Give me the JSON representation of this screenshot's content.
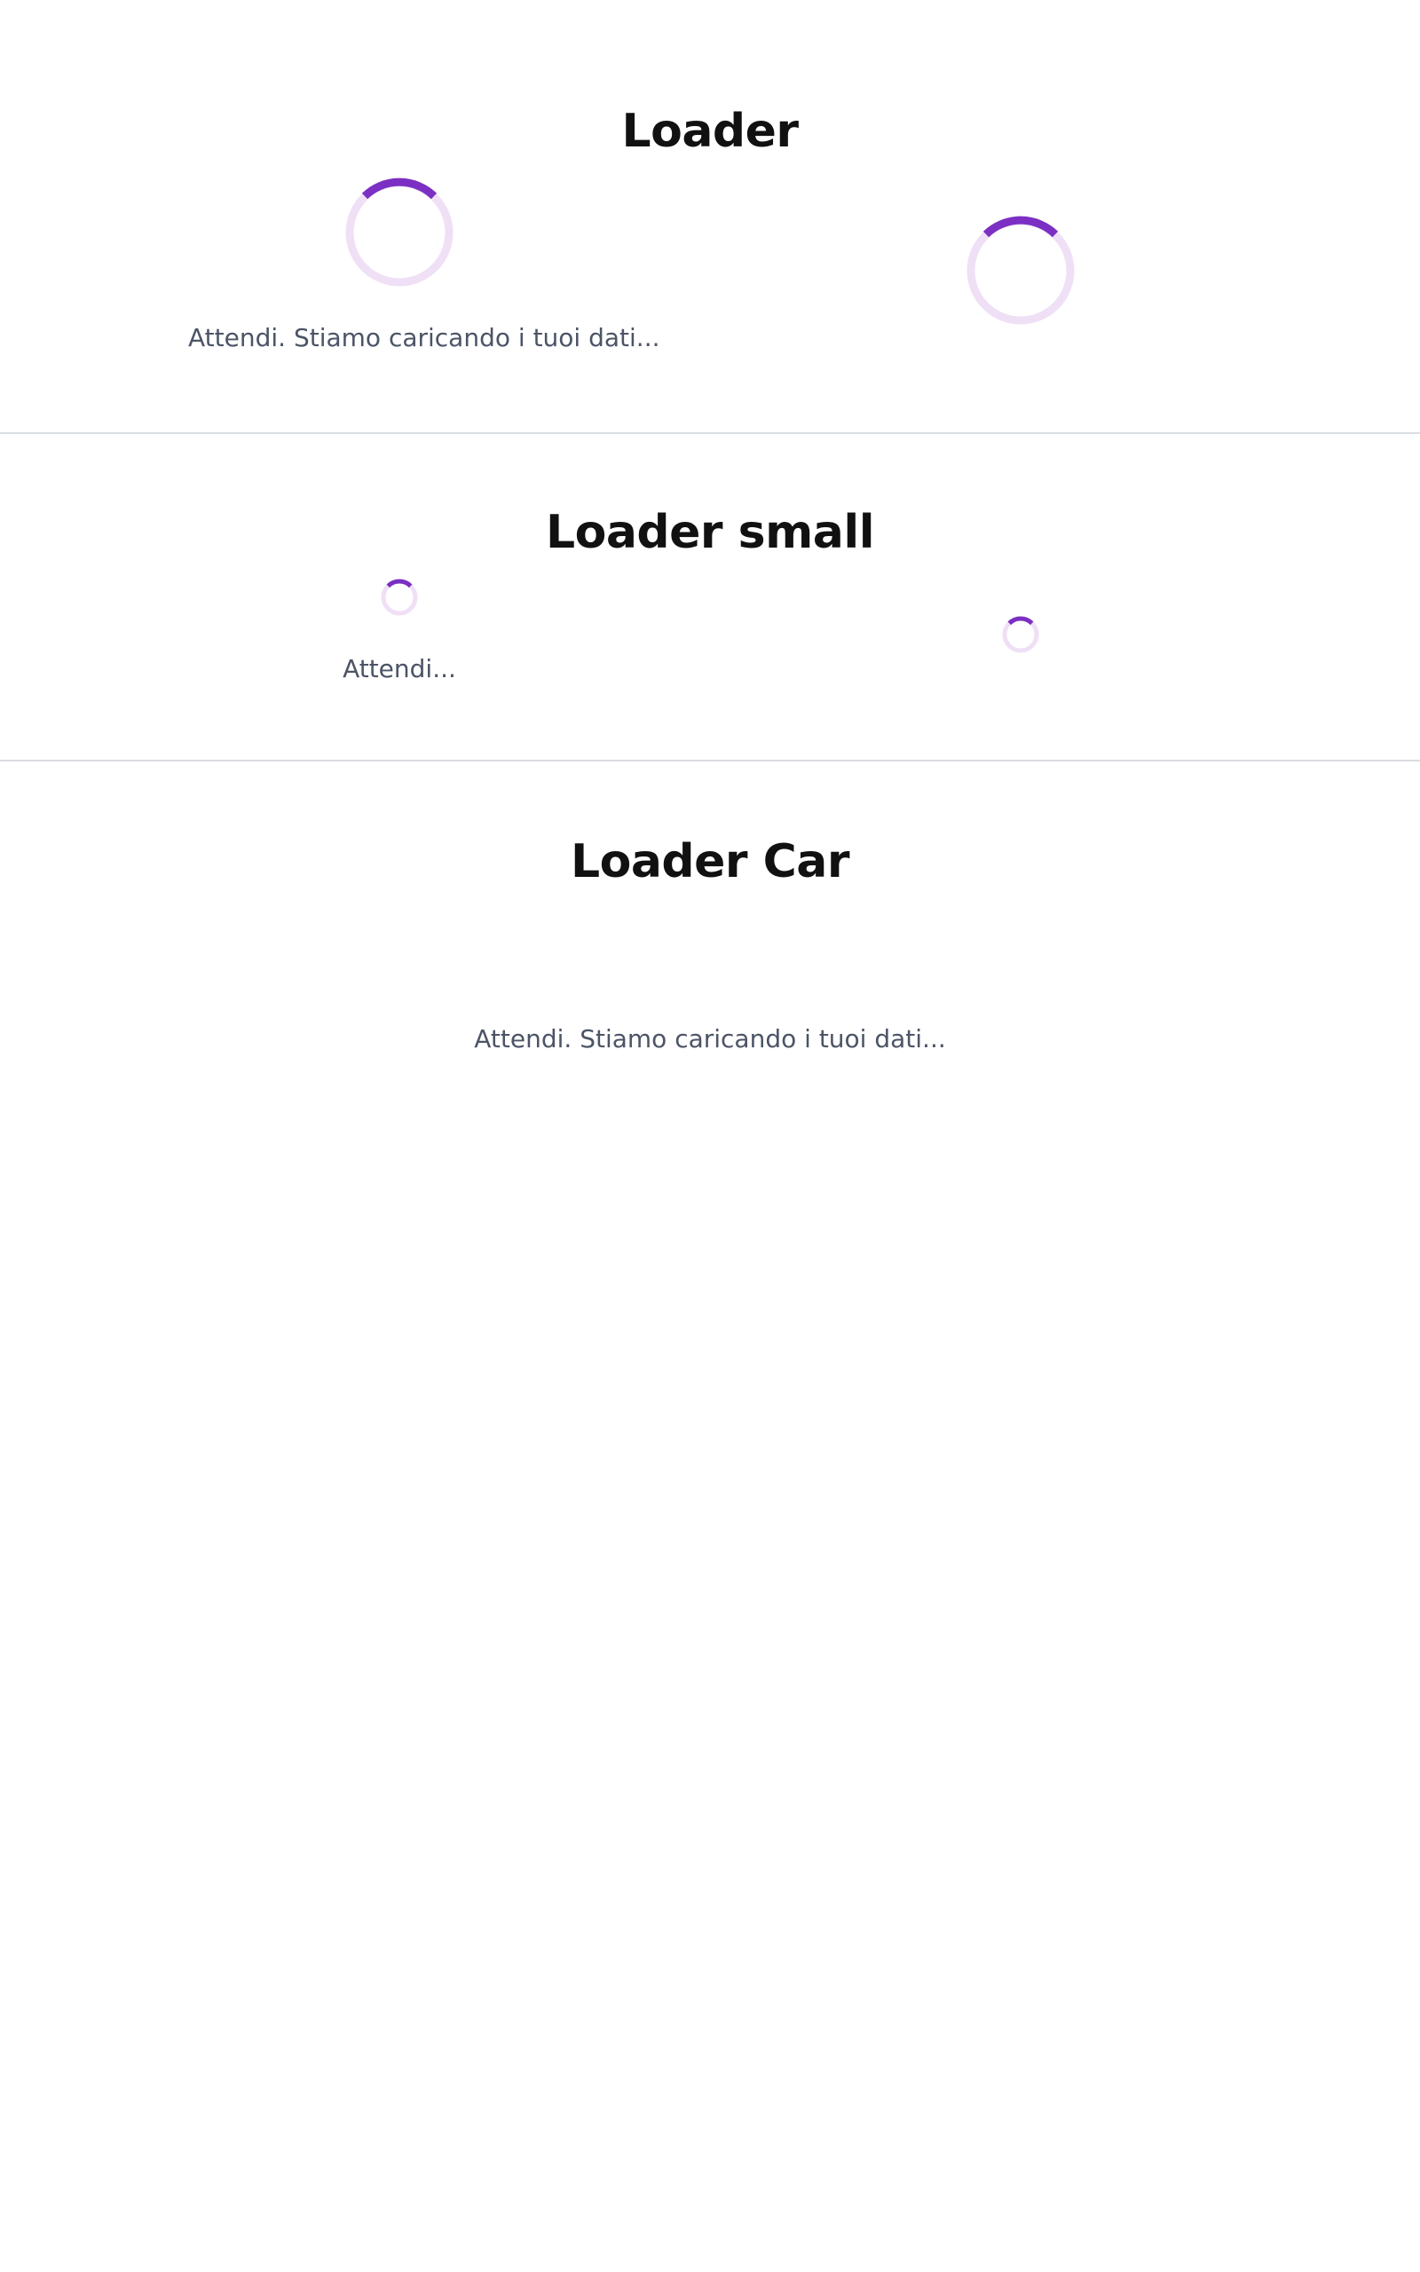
{
  "colors": {
    "spinner_accent": "#7b2fc3",
    "spinner_track": "#efe0f6",
    "caption_text": "#4c5466",
    "heading_text": "#111111",
    "divider": "#dadde2"
  },
  "sections": {
    "loader": {
      "title": "Loader",
      "caption": "Attendi. Stiamo caricando i tuoi dati..."
    },
    "loader_small": {
      "title": "Loader small",
      "caption": "Attendi..."
    },
    "loader_car": {
      "title": "Loader Car",
      "caption": "Attendi. Stiamo caricando i tuoi dati..."
    }
  }
}
